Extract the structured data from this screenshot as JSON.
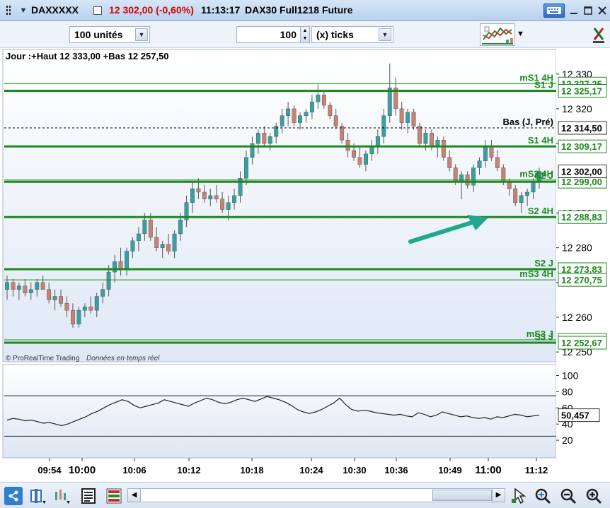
{
  "window": {
    "symbol": "DAXXXXX",
    "price_change": "12 302,00 (-0,60%)",
    "time": "11:13:17",
    "instrument": "DAX30 Full1218 Future",
    "colors": {
      "title_red": "#d40000",
      "bg": "#dde8f8"
    }
  },
  "toolbar": {
    "units_value": "100 unités",
    "ticks_number": "100",
    "ticks_unit": "(x) ticks",
    "icons": [
      "chart-type-icon",
      "dropdown-icon"
    ]
  },
  "chart_data": [
    {
      "type": "candlestick",
      "title": "Jour :+Haut 12 333,00 +Bas 12 257,50",
      "watermark": "© ProRealTime Trading",
      "watermark_sub": "Données en temps réel",
      "ylim": [
        12248,
        12333
      ],
      "y_ticks": [
        {
          "v": 12330,
          "label": "12 330"
        },
        {
          "v": 12320,
          "label": "12 320"
        },
        {
          "v": 12310,
          "label": "12 310"
        },
        {
          "v": 12290,
          "label": "12 290"
        },
        {
          "v": 12280,
          "label": "12 280"
        },
        {
          "v": 12270,
          "label": "12 270"
        },
        {
          "v": 12260,
          "label": "12 260"
        },
        {
          "v": 12250,
          "label": "12 250"
        }
      ],
      "levels": [
        {
          "name": "mS1 4H",
          "value": 12327.25,
          "tag": "12 327,25",
          "color": "#1c8a1c",
          "style": "solid",
          "lw": 1
        },
        {
          "name": "S1 J",
          "value": 12325.17,
          "tag": "12 325,17",
          "color": "#1c8a1c",
          "style": "solid",
          "lw": 3
        },
        {
          "name": "Bas (J, Pré)",
          "value": 12314.5,
          "tag": "12 314,50",
          "color": "#000000",
          "style": "dash",
          "lw": 1
        },
        {
          "name": "S1 4H",
          "value": 12309.17,
          "tag": "12 309,17",
          "color": "#1c8a1c",
          "style": "solid",
          "lw": 3
        },
        {
          "name": "mS2 4H",
          "value": 12299.5,
          "tag": "12 299,50",
          "color": "#1c8a1c",
          "style": "solid",
          "lw": 1
        },
        {
          "name": "S2 J",
          "value": 12299.0,
          "tag": "12 299,00",
          "color": "#1c8a1c",
          "style": "solid",
          "lw": 3
        },
        {
          "name": "S2 4H",
          "value": 12288.83,
          "tag": "12 288,83",
          "color": "#1c8a1c",
          "style": "solid",
          "lw": 3
        },
        {
          "name": "S2 J",
          "value": 12273.83,
          "tag": "12 273,83",
          "color": "#1c8a1c",
          "style": "solid",
          "lw": 3
        },
        {
          "name": "mS3 4H",
          "value": 12270.75,
          "tag": "12 270,75",
          "color": "#1c8a1c",
          "style": "solid",
          "lw": 1
        },
        {
          "name": "mS3 J",
          "value": 12253.5,
          "tag": "12 253,50",
          "color": "#1c8a1c",
          "style": "solid",
          "lw": 1
        },
        {
          "name": "S3 J",
          "value": 12252.67,
          "tag": "12 252,67",
          "color": "#1c8a1c",
          "style": "solid",
          "lw": 3
        }
      ],
      "current_price": {
        "value": 12302.0,
        "tag": "12 302,00"
      },
      "up_color": "#3a9fa0",
      "down_color": "#c9826f",
      "candles": [
        [
          12268,
          12272,
          12265,
          12270
        ],
        [
          12270,
          12271,
          12266,
          12268
        ],
        [
          12268,
          12270,
          12265,
          12269
        ],
        [
          12269,
          12271,
          12266,
          12267
        ],
        [
          12267,
          12270,
          12265,
          12268
        ],
        [
          12268,
          12271,
          12266,
          12270
        ],
        [
          12270,
          12272,
          12268,
          12268
        ],
        [
          12268,
          12270,
          12264,
          12265
        ],
        [
          12265,
          12268,
          12262,
          12266
        ],
        [
          12266,
          12268,
          12263,
          12264
        ],
        [
          12264,
          12266,
          12260,
          12262
        ],
        [
          12262,
          12264,
          12257,
          12258
        ],
        [
          12258,
          12263,
          12257,
          12262
        ],
        [
          12262,
          12264,
          12260,
          12263
        ],
        [
          12263,
          12266,
          12261,
          12262
        ],
        [
          12262,
          12267,
          12260,
          12266
        ],
        [
          12266,
          12270,
          12264,
          12268
        ],
        [
          12268,
          12275,
          12266,
          12273
        ],
        [
          12273,
          12278,
          12270,
          12276
        ],
        [
          12276,
          12280,
          12272,
          12274
        ],
        [
          12274,
          12280,
          12272,
          12279
        ],
        [
          12279,
          12283,
          12277,
          12282
        ],
        [
          12282,
          12286,
          12279,
          12284
        ],
        [
          12284,
          12290,
          12282,
          12288
        ],
        [
          12288,
          12290,
          12282,
          12283
        ],
        [
          12283,
          12286,
          12279,
          12280
        ],
        [
          12280,
          12282,
          12277,
          12281
        ],
        [
          12281,
          12284,
          12278,
          12279
        ],
        [
          12279,
          12285,
          12277,
          12284
        ],
        [
          12284,
          12290,
          12282,
          12288
        ],
        [
          12288,
          12295,
          12286,
          12293
        ],
        [
          12293,
          12299,
          12290,
          12297
        ],
        [
          12297,
          12300,
          12294,
          12296
        ],
        [
          12296,
          12298,
          12293,
          12294
        ],
        [
          12294,
          12297,
          12292,
          12295
        ],
        [
          12295,
          12298,
          12293,
          12294
        ],
        [
          12294,
          12296,
          12290,
          12291
        ],
        [
          12291,
          12295,
          12288,
          12293
        ],
        [
          12293,
          12297,
          12291,
          12295
        ],
        [
          12295,
          12302,
          12293,
          12300
        ],
        [
          12300,
          12308,
          12298,
          12306
        ],
        [
          12306,
          12312,
          12304,
          12310
        ],
        [
          12310,
          12314,
          12307,
          12313
        ],
        [
          12313,
          12315,
          12309,
          12310
        ],
        [
          12310,
          12313,
          12308,
          12312
        ],
        [
          12312,
          12316,
          12310,
          12315
        ],
        [
          12315,
          12320,
          12313,
          12318
        ],
        [
          12318,
          12322,
          12315,
          12320
        ],
        [
          12320,
          12321,
          12315,
          12316
        ],
        [
          12316,
          12319,
          12314,
          12318
        ],
        [
          12318,
          12320,
          12316,
          12319
        ],
        [
          12319,
          12324,
          12317,
          12322
        ],
        [
          12322,
          12327,
          12320,
          12324
        ],
        [
          12324,
          12325,
          12320,
          12321
        ],
        [
          12321,
          12322,
          12317,
          12318
        ],
        [
          12318,
          12320,
          12314,
          12315
        ],
        [
          12315,
          12316,
          12310,
          12311
        ],
        [
          12311,
          12313,
          12306,
          12308
        ],
        [
          12308,
          12310,
          12305,
          12306
        ],
        [
          12306,
          12309,
          12303,
          12304
        ],
        [
          12304,
          12308,
          12302,
          12307
        ],
        [
          12307,
          12311,
          12305,
          12309
        ],
        [
          12309,
          12314,
          12307,
          12312
        ],
        [
          12312,
          12320,
          12310,
          12318
        ],
        [
          12318,
          12333,
          12316,
          12326
        ],
        [
          12326,
          12329,
          12318,
          12320
        ],
        [
          12320,
          12322,
          12314,
          12316
        ],
        [
          12316,
          12320,
          12313,
          12319
        ],
        [
          12319,
          12320,
          12314,
          12315
        ],
        [
          12315,
          12316,
          12309,
          12310
        ],
        [
          12310,
          12314,
          12308,
          12313
        ],
        [
          12313,
          12314,
          12308,
          12309
        ],
        [
          12309,
          12312,
          12306,
          12311
        ],
        [
          12311,
          12312,
          12305,
          12306
        ],
        [
          12306,
          12308,
          12302,
          12303
        ],
        [
          12303,
          12304,
          12298,
          12299
        ],
        [
          12299,
          12302,
          12294,
          12301
        ],
        [
          12301,
          12302,
          12297,
          12298
        ],
        [
          12298,
          12304,
          12296,
          12303
        ],
        [
          12303,
          12306,
          12301,
          12305
        ],
        [
          12305,
          12311,
          12303,
          12309
        ],
        [
          12309,
          12311,
          12305,
          12306
        ],
        [
          12306,
          12308,
          12302,
          12303
        ],
        [
          12303,
          12304,
          12298,
          12299
        ],
        [
          12299,
          12300,
          12295,
          12297
        ],
        [
          12297,
          12298,
          12292,
          12293
        ],
        [
          12293,
          12296,
          12290,
          12295
        ],
        [
          12295,
          12297,
          12292,
          12296
        ],
        [
          12296,
          12300,
          12294,
          12299
        ],
        [
          12299,
          12303,
          12297,
          12302
        ]
      ]
    },
    {
      "type": "line",
      "ylim": [
        0,
        110
      ],
      "y_ticks": [
        {
          "v": 100,
          "label": "100"
        },
        {
          "v": 80,
          "label": "80"
        },
        {
          "v": 60,
          "label": "60"
        },
        {
          "v": 40,
          "label": "40"
        },
        {
          "v": 20,
          "label": "20"
        }
      ],
      "hlines": [
        75,
        25
      ],
      "current_tag": "50,457",
      "values": [
        45,
        47,
        46,
        44,
        45,
        43,
        41,
        42,
        40,
        38,
        40,
        43,
        46,
        49,
        53,
        56,
        60,
        64,
        67,
        70,
        68,
        63,
        60,
        62,
        64,
        66,
        70,
        68,
        66,
        64,
        62,
        66,
        69,
        72,
        70,
        67,
        65,
        67,
        70,
        72,
        70,
        68,
        71,
        74,
        72,
        70,
        67,
        63,
        58,
        55,
        53,
        55,
        58,
        62,
        66,
        72,
        64,
        58,
        56,
        57,
        56,
        54,
        53,
        52,
        51,
        52,
        50,
        49,
        54,
        52,
        49,
        51,
        55,
        53,
        51,
        49,
        50,
        48,
        47,
        48,
        46,
        49,
        48,
        50,
        52,
        51,
        49,
        50,
        51
      ]
    }
  ],
  "x_axis": {
    "labels": [
      "09:54",
      "10:00",
      "10:06",
      "10:12",
      "10:18",
      "10:24",
      "10:30",
      "10:36",
      "10:49",
      "11:00",
      "11:12"
    ]
  },
  "bottom": {
    "icons": [
      "share-icon",
      "indicator-icon",
      "drawing-tools-icon",
      "list-icon",
      "scroll-left-icon",
      "scroll-right-icon",
      "cursor-icon",
      "zoom-fit-icon",
      "zoom-out-icon",
      "zoom-in-icon"
    ]
  }
}
